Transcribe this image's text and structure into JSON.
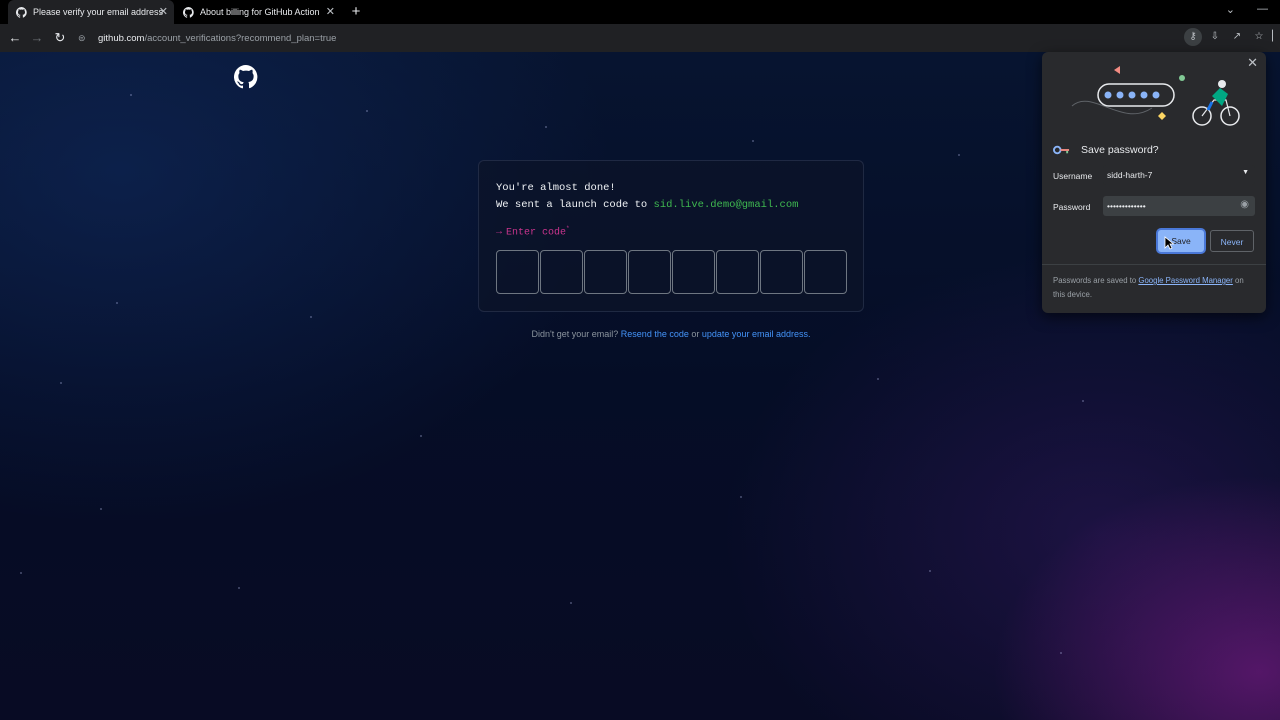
{
  "browser": {
    "tabs": [
      {
        "title": "Please verify your email address",
        "active": true
      },
      {
        "title": "About billing for GitHub Actions",
        "active": false
      }
    ],
    "url_host": "github.com",
    "url_path": "/account_verifications?recommend_plan=true"
  },
  "verify": {
    "line1": "You're almost done!",
    "line2_prefix": "We sent a launch code to ",
    "email": "sid.live.demo@gmail.com",
    "prompt_arrow": "→",
    "prompt_label": "Enter code",
    "prompt_required": "*",
    "resend_prefix": "Didn't get your email?",
    "resend_link": "Resend the code",
    "resend_or": "or",
    "update_link": "update your email address."
  },
  "password_popup": {
    "title": "Save password?",
    "username_label": "Username",
    "username_value": "sidd-harth-7",
    "password_label": "Password",
    "password_value": "•••••••••••••",
    "save_label": "Save",
    "never_label": "Never",
    "footer_prefix": "Passwords are saved to ",
    "footer_link": "Google Password Manager",
    "footer_suffix": " on this device."
  },
  "colors": {
    "email_green": "#3fb950",
    "prompt_pink": "#c9348d",
    "link_blue": "#4493f8",
    "chrome_bg": "#202124",
    "popup_accent": "#8ab4f8"
  }
}
